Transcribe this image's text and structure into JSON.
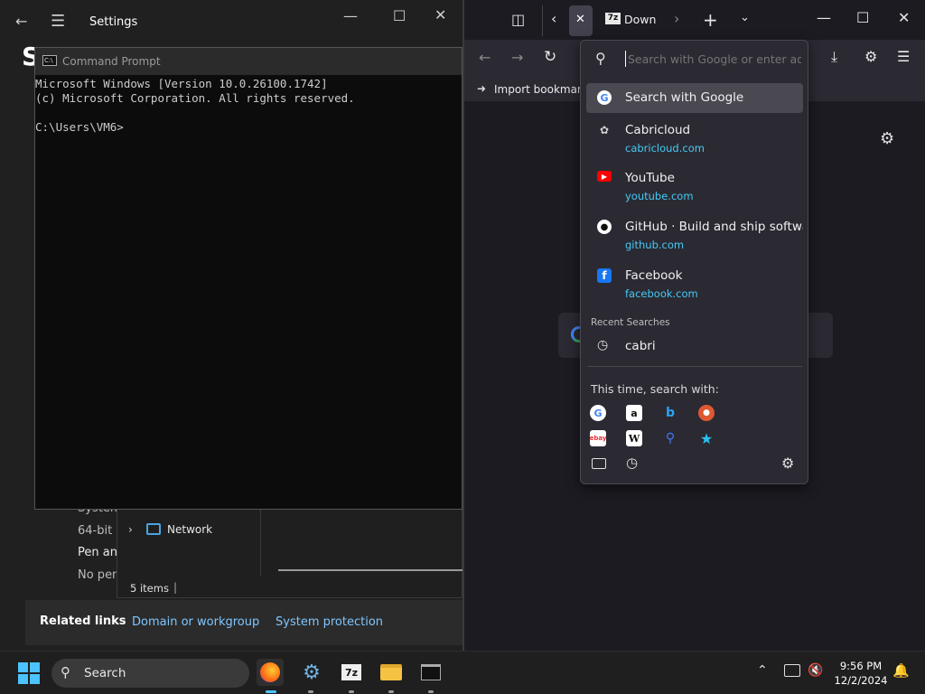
{
  "settings": {
    "title": "Settings",
    "heading_fragment": "S",
    "list_text": [
      "System",
      "64-bit",
      "Pen and",
      "No pen"
    ],
    "related_links_label": "Related links",
    "links": [
      "Domain or workgroup",
      "System protection"
    ]
  },
  "explorer": {
    "tree_item": "Network",
    "status": "5 items"
  },
  "cmd": {
    "title": "Command Prompt",
    "lines": [
      "Microsoft Windows [Version 10.0.26100.1742]",
      "(c) Microsoft Corporation. All rights reserved.",
      "",
      "C:\\Users\\VM6>"
    ]
  },
  "firefox": {
    "tab_label": "Down",
    "tab_badge": "7z",
    "bookmark": "Import bookmarks...",
    "search_placeholder": "Search with Google or enter address",
    "suggestions": [
      {
        "title": "Search with Google",
        "url": "",
        "icon": "google-icon"
      },
      {
        "title": "Cabricloud",
        "url": "cabricloud.com",
        "icon": "cabricloud-icon"
      },
      {
        "title": "YouTube",
        "url": "youtube.com",
        "icon": "youtube-icon"
      },
      {
        "title": "GitHub · Build and ship software",
        "url": "github.com",
        "icon": "github-icon"
      },
      {
        "title": "Facebook",
        "url": "facebook.com",
        "icon": "facebook-icon"
      }
    ],
    "recent_header": "Recent Searches",
    "recent_items": [
      "cabri"
    ],
    "this_time_label": "This time, search with:",
    "engines": [
      "google",
      "amazon",
      "bing",
      "duckduckgo",
      "ebay",
      "wikipedia",
      "search",
      "bookmarks-star"
    ]
  },
  "taskbar": {
    "search_label": "Search",
    "time": "9:56 PM",
    "date": "12/2/2024",
    "apps": [
      "firefox",
      "settings",
      "7zip",
      "file-explorer",
      "command-prompt"
    ]
  },
  "colors": {
    "accent_link": "#7fc6ff",
    "url_blue": "#45c9f5",
    "firefox_bg": "#1c1b22",
    "dropdown_bg": "#2b2a33"
  }
}
